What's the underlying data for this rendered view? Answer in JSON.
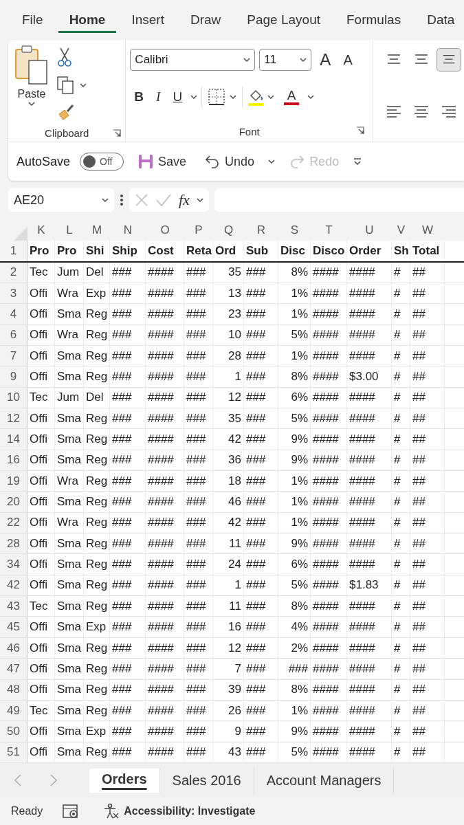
{
  "menu_tabs": [
    {
      "label": "File",
      "selected": false
    },
    {
      "label": "Home",
      "selected": true
    },
    {
      "label": "Insert",
      "selected": false
    },
    {
      "label": "Draw",
      "selected": false
    },
    {
      "label": "Page Layout",
      "selected": false
    },
    {
      "label": "Formulas",
      "selected": false
    },
    {
      "label": "Data",
      "selected": false
    }
  ],
  "ribbon": {
    "clipboard": {
      "paste": "Paste",
      "label": "Clipboard"
    },
    "font": {
      "font_name": "Calibri",
      "font_size": "11",
      "grow": "A",
      "shrink": "A",
      "bold": "B",
      "italic": "I",
      "underline": "U",
      "font_color": "A",
      "label": "Font"
    }
  },
  "quick_access": {
    "autosave": {
      "label": "AutoSave",
      "on": false,
      "state_text": "Off"
    },
    "save": "Save",
    "undo": "Undo",
    "redo": {
      "label": "Redo",
      "disabled": true
    }
  },
  "formula_bar": {
    "name_box": "AE20",
    "fx": "fx"
  },
  "columns": [
    "K",
    "L",
    "M",
    "N",
    "O",
    "P",
    "Q",
    "R",
    "S",
    "T",
    "U",
    "V",
    "W"
  ],
  "header_row": {
    "number": "1",
    "cells": [
      "Pro",
      "Pro",
      "Shi",
      "Ship",
      "Cost",
      "Reta",
      "Ord",
      "Sub",
      "Disc",
      "Disco",
      "Order",
      "Sh",
      "Total"
    ]
  },
  "rows": [
    {
      "number": "2",
      "cells": [
        "Tec",
        "Jum",
        "Del",
        "###",
        "####",
        "###",
        "35",
        "###",
        "8%",
        "####",
        "####",
        "#",
        "##"
      ]
    },
    {
      "number": "3",
      "cells": [
        "Offi",
        "Wra",
        "Exp",
        "###",
        "####",
        "###",
        "13",
        "###",
        "1%",
        "####",
        "####",
        "#",
        "##"
      ]
    },
    {
      "number": "4",
      "cells": [
        "Offi",
        "Sma",
        "Reg",
        "###",
        "####",
        "###",
        "23",
        "###",
        "1%",
        "####",
        "####",
        "#",
        "##"
      ]
    },
    {
      "number": "6",
      "cells": [
        "Offi",
        "Wra",
        "Reg",
        "###",
        "####",
        "###",
        "10",
        "###",
        "5%",
        "####",
        "####",
        "#",
        "##"
      ]
    },
    {
      "number": "7",
      "cells": [
        "Offi",
        "Sma",
        "Reg",
        "###",
        "####",
        "###",
        "28",
        "###",
        "1%",
        "####",
        "####",
        "#",
        "##"
      ]
    },
    {
      "number": "9",
      "cells": [
        "Offi",
        "Sma",
        "Reg",
        "###",
        "####",
        "###",
        "1",
        "###",
        "8%",
        "####",
        "$3.00",
        "#",
        "##"
      ]
    },
    {
      "number": "10",
      "cells": [
        "Tec",
        "Jum",
        "Del",
        "###",
        "####",
        "###",
        "12",
        "###",
        "6%",
        "####",
        "####",
        "#",
        "##"
      ]
    },
    {
      "number": "12",
      "cells": [
        "Offi",
        "Sma",
        "Reg",
        "###",
        "####",
        "###",
        "35",
        "###",
        "5%",
        "####",
        "####",
        "#",
        "##"
      ]
    },
    {
      "number": "14",
      "cells": [
        "Offi",
        "Sma",
        "Reg",
        "###",
        "####",
        "###",
        "42",
        "###",
        "9%",
        "####",
        "####",
        "#",
        "##"
      ]
    },
    {
      "number": "16",
      "cells": [
        "Offi",
        "Sma",
        "Reg",
        "###",
        "####",
        "###",
        "36",
        "###",
        "9%",
        "####",
        "####",
        "#",
        "##"
      ]
    },
    {
      "number": "19",
      "cells": [
        "Offi",
        "Wra",
        "Reg",
        "###",
        "####",
        "###",
        "18",
        "###",
        "1%",
        "####",
        "####",
        "#",
        "##"
      ]
    },
    {
      "number": "20",
      "cells": [
        "Offi",
        "Sma",
        "Reg",
        "###",
        "####",
        "###",
        "46",
        "###",
        "1%",
        "####",
        "####",
        "#",
        "##"
      ]
    },
    {
      "number": "22",
      "cells": [
        "Offi",
        "Wra",
        "Reg",
        "###",
        "####",
        "###",
        "42",
        "###",
        "1%",
        "####",
        "####",
        "#",
        "##"
      ]
    },
    {
      "number": "28",
      "cells": [
        "Offi",
        "Sma",
        "Reg",
        "###",
        "####",
        "###",
        "11",
        "###",
        "9%",
        "####",
        "####",
        "#",
        "##"
      ]
    },
    {
      "number": "34",
      "cells": [
        "Offi",
        "Sma",
        "Reg",
        "###",
        "####",
        "###",
        "24",
        "###",
        "6%",
        "####",
        "####",
        "#",
        "##"
      ]
    },
    {
      "number": "42",
      "cells": [
        "Offi",
        "Sma",
        "Reg",
        "###",
        "####",
        "###",
        "1",
        "###",
        "5%",
        "####",
        "$1.83",
        "#",
        "##"
      ]
    },
    {
      "number": "43",
      "cells": [
        "Tec",
        "Sma",
        "Reg",
        "###",
        "####",
        "###",
        "11",
        "###",
        "8%",
        "####",
        "####",
        "#",
        "##"
      ]
    },
    {
      "number": "45",
      "cells": [
        "Offi",
        "Sma",
        "Exp",
        "###",
        "####",
        "###",
        "16",
        "###",
        "4%",
        "####",
        "####",
        "#",
        "##"
      ]
    },
    {
      "number": "46",
      "cells": [
        "Offi",
        "Sma",
        "Reg",
        "###",
        "####",
        "###",
        "12",
        "###",
        "2%",
        "####",
        "####",
        "#",
        "##"
      ]
    },
    {
      "number": "47",
      "cells": [
        "Offi",
        "Sma",
        "Reg",
        "###",
        "####",
        "###",
        "7",
        "###",
        "###",
        "####",
        "####",
        "#",
        "##"
      ]
    },
    {
      "number": "48",
      "cells": [
        "Offi",
        "Sma",
        "Reg",
        "###",
        "####",
        "###",
        "39",
        "###",
        "8%",
        "####",
        "####",
        "#",
        "##"
      ]
    },
    {
      "number": "49",
      "cells": [
        "Tec",
        "Sma",
        "Reg",
        "###",
        "####",
        "###",
        "26",
        "###",
        "1%",
        "####",
        "####",
        "#",
        "##"
      ]
    },
    {
      "number": "50",
      "cells": [
        "Offi",
        "Sma",
        "Exp",
        "###",
        "####",
        "###",
        "9",
        "###",
        "9%",
        "####",
        "####",
        "#",
        "##"
      ]
    },
    {
      "number": "51",
      "cells": [
        "Offi",
        "Sma",
        "Reg",
        "###",
        "####",
        "###",
        "43",
        "###",
        "5%",
        "####",
        "####",
        "#",
        "##"
      ]
    }
  ],
  "sheet_tabs": [
    {
      "label": "Orders",
      "selected": true
    },
    {
      "label": "Sales 2016",
      "selected": false
    },
    {
      "label": "Account Managers",
      "selected": false
    }
  ],
  "status_bar": {
    "mode": "Ready",
    "accessibility": "Accessibility: Investigate"
  }
}
